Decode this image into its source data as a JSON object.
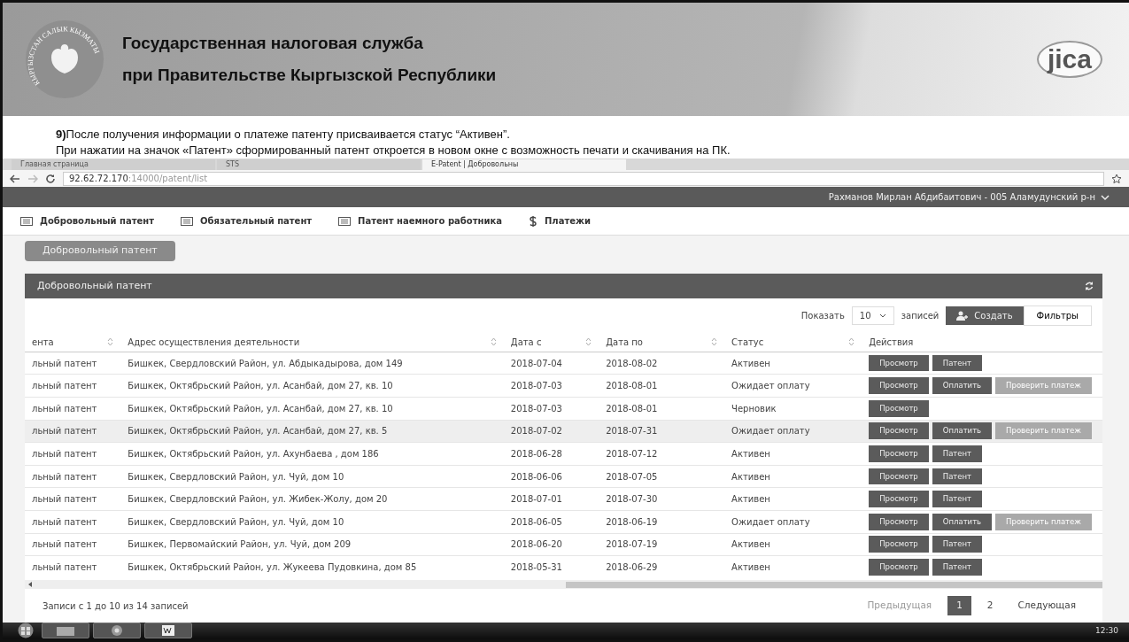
{
  "slide": {
    "emblem_text": "КЫРГЫЗСТАН САЛЫК КЫЗМАТЫ",
    "title_lines": [
      "Государственная налоговая служба",
      "при Правительстве Кыргызской Республики"
    ],
    "logo_text": "jica",
    "notes": [
      "**9)**После получения информации о платеже патенту присваивается статус “Активен”.",
      "При нажатии на значок «Патент» сформированный патент откроется в новом окне с возможность печати и скачивания на ПК."
    ]
  },
  "browser": {
    "tabs": [
      {
        "label": "Главная страница",
        "selected": false
      },
      {
        "label": "STS",
        "selected": false
      },
      {
        "label": "E-Patent | Добровольны",
        "selected": true
      }
    ],
    "address_host": "92.62.72.170",
    "address_path": ":14000/patent/list"
  },
  "app": {
    "user": "Рахманов Мирлан Абдибаитович - 005 Аламудунский р-н",
    "menu": [
      {
        "label": "Добровольный патент",
        "kind": "card"
      },
      {
        "label": "Обязательный патент",
        "kind": "card"
      },
      {
        "label": "Патент наемного работника",
        "kind": "card"
      },
      {
        "label": "Платежи",
        "kind": "dollar"
      }
    ],
    "page_button": "Добровольный патент",
    "panel_title": "Добровольный патент",
    "show_label": "Показать",
    "page_size": "10",
    "records_label": "записей",
    "create_button": "Создать",
    "filters_button": "Фильтры",
    "table": {
      "columns": [
        "ента",
        "Адрес осуществления деятельности",
        "Дата с",
        "Дата по",
        "Статус",
        "Действия"
      ],
      "rows": [
        {
          "type": "льный патент",
          "address": "Бишкек, Свердловский Район, ул. Абдыкадырова, дом 149",
          "date_from": "2018-07-04",
          "date_to": "2018-08-02",
          "status": "Активен",
          "highlighted": false,
          "actions": [
            {
              "label": "Просмотр",
              "disabled": false
            },
            {
              "label": "Патент",
              "disabled": false
            }
          ]
        },
        {
          "type": "льный патент",
          "address": "Бишкек, Октябрьский Район, ул. Асанбай, дом 27, кв. 10",
          "date_from": "2018-07-03",
          "date_to": "2018-08-01",
          "status": "Ожидает оплату",
          "highlighted": false,
          "actions": [
            {
              "label": "Просмотр",
              "disabled": false
            },
            {
              "label": "Оплатить",
              "disabled": false
            },
            {
              "label": "Проверить платеж",
              "disabled": true
            }
          ]
        },
        {
          "type": "льный патент",
          "address": "Бишкек, Октябрьский Район, ул. Асанбай, дом 27, кв. 10",
          "date_from": "2018-07-03",
          "date_to": "2018-08-01",
          "status": "Черновик",
          "highlighted": false,
          "actions": [
            {
              "label": "Просмотр",
              "disabled": false
            }
          ]
        },
        {
          "type": "льный патент",
          "address": "Бишкек, Октябрьский Район, ул. Асанбай, дом 27, кв. 5",
          "date_from": "2018-07-02",
          "date_to": "2018-07-31",
          "status": "Ожидает оплату",
          "highlighted": true,
          "actions": [
            {
              "label": "Просмотр",
              "disabled": false
            },
            {
              "label": "Оплатить",
              "disabled": false
            },
            {
              "label": "Проверить платеж",
              "disabled": true
            }
          ]
        },
        {
          "type": "льный патент",
          "address": "Бишкек, Октябрьский Район, ул. Ахунбаева , дом 186",
          "date_from": "2018-06-28",
          "date_to": "2018-07-12",
          "status": "Активен",
          "highlighted": false,
          "actions": [
            {
              "label": "Просмотр",
              "disabled": false
            },
            {
              "label": "Патент",
              "disabled": false
            }
          ]
        },
        {
          "type": "льный патент",
          "address": "Бишкек, Свердловский Район, ул. Чуй, дом 10",
          "date_from": "2018-06-06",
          "date_to": "2018-07-05",
          "status": "Активен",
          "highlighted": false,
          "actions": [
            {
              "label": "Просмотр",
              "disabled": false
            },
            {
              "label": "Патент",
              "disabled": false
            }
          ]
        },
        {
          "type": "льный патент",
          "address": "Бишкек, Свердловский Район, ул. Жибек-Жолу, дом 20",
          "date_from": "2018-07-01",
          "date_to": "2018-07-30",
          "status": "Активен",
          "highlighted": false,
          "actions": [
            {
              "label": "Просмотр",
              "disabled": false
            },
            {
              "label": "Патент",
              "disabled": false
            }
          ]
        },
        {
          "type": "льный патент",
          "address": "Бишкек, Свердловский Район, ул. Чуй, дом 10",
          "date_from": "2018-06-05",
          "date_to": "2018-06-19",
          "status": "Ожидает оплату",
          "highlighted": false,
          "actions": [
            {
              "label": "Просмотр",
              "disabled": false
            },
            {
              "label": "Оплатить",
              "disabled": false
            },
            {
              "label": "Проверить платеж",
              "disabled": true
            }
          ]
        },
        {
          "type": "льный патент",
          "address": "Бишкек, Первомайский Район, ул. Чуй, дом 209",
          "date_from": "2018-06-20",
          "date_to": "2018-07-19",
          "status": "Активен",
          "highlighted": false,
          "actions": [
            {
              "label": "Просмотр",
              "disabled": false
            },
            {
              "label": "Патент",
              "disabled": false
            }
          ]
        },
        {
          "type": "льный патент",
          "address": "Бишкек, Октябрьский Район, ул. Жукеева Пудовкина, дом 85",
          "date_from": "2018-05-31",
          "date_to": "2018-06-29",
          "status": "Активен",
          "highlighted": false,
          "actions": [
            {
              "label": "Просмотр",
              "disabled": false
            },
            {
              "label": "Патент",
              "disabled": false
            }
          ]
        }
      ]
    },
    "info": "Записи с 1 до 10 из 14 записей",
    "pagination": {
      "previous": "Предыдущая",
      "pages": [
        {
          "label": "1",
          "selected": true
        },
        {
          "label": "2",
          "selected": false
        }
      ],
      "next": "Следующая"
    }
  },
  "taskbar": {
    "clock": "12:30"
  }
}
